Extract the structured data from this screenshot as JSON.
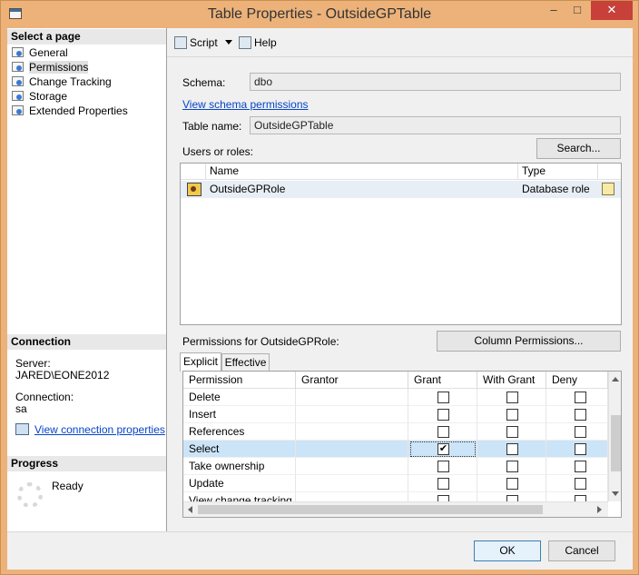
{
  "window": {
    "title": "Table Properties - OutsideGPTable",
    "minimize": "–",
    "maximize": "□",
    "close": "✕"
  },
  "sidebar": {
    "select_page_header": "Select a page",
    "pages": [
      {
        "label": "General",
        "icon": "page-icon",
        "selected": false
      },
      {
        "label": "Permissions",
        "icon": "page-icon",
        "selected": true
      },
      {
        "label": "Change Tracking",
        "icon": "page-icon",
        "selected": false
      },
      {
        "label": "Storage",
        "icon": "page-icon",
        "selected": false
      },
      {
        "label": "Extended Properties",
        "icon": "page-icon",
        "selected": false
      }
    ],
    "connection_header": "Connection",
    "server_label": "Server:",
    "server_value": "JARED\\EONE2012",
    "connection_label": "Connection:",
    "connection_value": "sa",
    "view_connection_link": "View connection properties",
    "progress_header": "Progress",
    "progress_status": "Ready"
  },
  "toolbar": {
    "script_label": "Script",
    "help_label": "Help"
  },
  "main": {
    "schema_label": "Schema:",
    "schema_value": "dbo",
    "view_schema_link": "View schema permissions",
    "table_name_label": "Table name:",
    "table_name_value": "OutsideGPTable",
    "users_roles_label": "Users or roles:",
    "search_button": "Search...",
    "users_columns": [
      "Name",
      "Type"
    ],
    "users": [
      {
        "name": "OutsideGPRole",
        "type": "Database role"
      }
    ],
    "permissions_for_label": "Permissions for OutsideGPRole:",
    "column_permissions_button": "Column Permissions...",
    "tabs": [
      {
        "label": "Explicit",
        "active": true
      },
      {
        "label": "Effective",
        "active": false
      }
    ],
    "perm_columns": [
      "Permission",
      "Grantor",
      "Grant",
      "With Grant",
      "Deny"
    ],
    "permissions": [
      {
        "name": "Delete",
        "grantor": "",
        "grant": false,
        "with_grant": false,
        "deny": false,
        "selected": false
      },
      {
        "name": "Insert",
        "grantor": "",
        "grant": false,
        "with_grant": false,
        "deny": false,
        "selected": false
      },
      {
        "name": "References",
        "grantor": "",
        "grant": false,
        "with_grant": false,
        "deny": false,
        "selected": false
      },
      {
        "name": "Select",
        "grantor": "",
        "grant": true,
        "with_grant": false,
        "deny": false,
        "selected": true
      },
      {
        "name": "Take ownership",
        "grantor": "",
        "grant": false,
        "with_grant": false,
        "deny": false,
        "selected": false
      },
      {
        "name": "Update",
        "grantor": "",
        "grant": false,
        "with_grant": false,
        "deny": false,
        "selected": false
      },
      {
        "name": "View change tracking",
        "grantor": "",
        "grant": false,
        "with_grant": false,
        "deny": false,
        "selected": false
      }
    ]
  },
  "footer": {
    "ok_button": "OK",
    "cancel_button": "Cancel"
  }
}
